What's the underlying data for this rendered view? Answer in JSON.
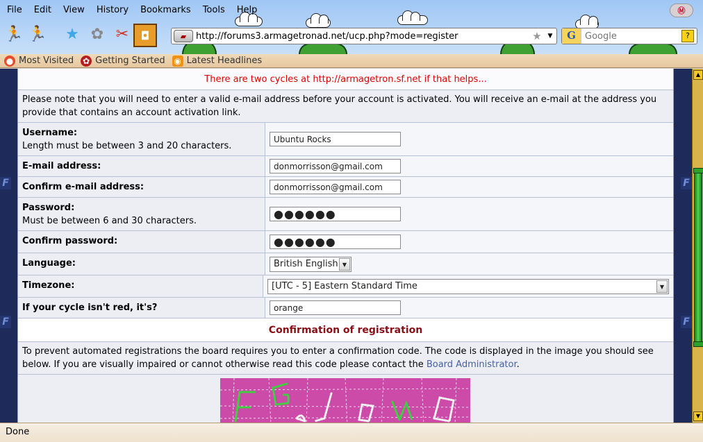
{
  "menu": [
    "File",
    "Edit",
    "View",
    "History",
    "Bookmarks",
    "Tools",
    "Help"
  ],
  "url": "http://forums3.armagetronad.net/ucp.php?mode=register",
  "search": {
    "placeholder": "Google"
  },
  "bookmarks": [
    "Most Visited",
    "Getting Started",
    "Latest Headlines"
  ],
  "notice": "There are two cycles at http://armagetron.sf.net if that helps...",
  "intro": "Please note that you will need to enter a valid e-mail address before your account is activated. You will receive an e-mail at the address you provide that contains an account activation link.",
  "form": {
    "username": {
      "label": "Username:",
      "hint": "Length must be between 3 and 20 characters.",
      "value": "Ubuntu Rocks"
    },
    "email": {
      "label": "E-mail address:",
      "value": "donmorrisson@gmail.com"
    },
    "email_confirm": {
      "label": "Confirm e-mail address:",
      "value": "donmorrisson@gmail.com"
    },
    "password": {
      "label": "Password:",
      "hint": "Must be between 6 and 30 characters.",
      "masked": "●●●●●●"
    },
    "password_confirm": {
      "label": "Confirm password:",
      "masked": "●●●●●●"
    },
    "language": {
      "label": "Language:",
      "value": "British English"
    },
    "timezone": {
      "label": "Timezone:",
      "value": "[UTC - 5] Eastern Standard Time"
    },
    "cycle": {
      "label": "If your cycle isn't red, it's?",
      "value": "orange"
    }
  },
  "confirmation": {
    "heading": "Confirmation of registration",
    "text": "To prevent automated registrations the board requires you to enter a confirmation code. The code is displayed in the image you should see below. If you are visually impaired or cannot otherwise read this code please contact the",
    "link": "Board Administrator",
    "text_end": "."
  },
  "status": "Done",
  "colors": {
    "notice": "#e00000",
    "heading": "#8a0f17",
    "link": "#4660a8",
    "captcha_bg": "#cc4aa8"
  }
}
